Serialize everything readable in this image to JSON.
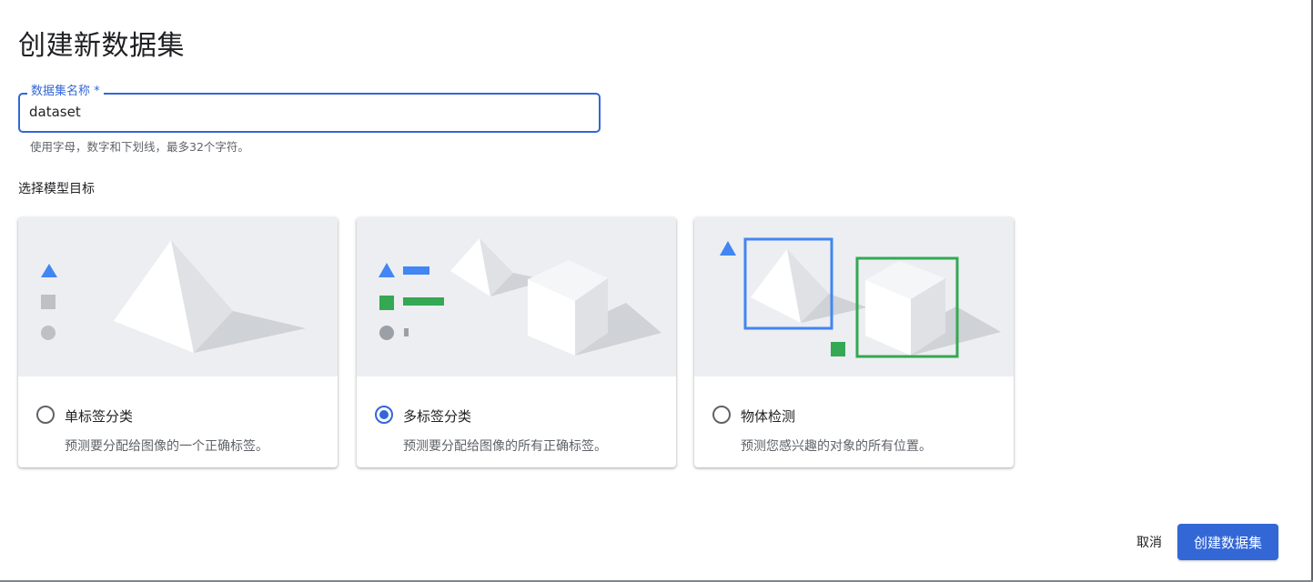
{
  "dialog": {
    "title": "创建新数据集"
  },
  "dataset_name": {
    "label": "数据集名称 *",
    "value": "dataset",
    "hint": "使用字母，数字和下划线，最多32个字符。"
  },
  "objective": {
    "section_label": "选择模型目标",
    "options": [
      {
        "title": "单标签分类",
        "description": "预测要分配给图像的一个正确标签。",
        "selected": false
      },
      {
        "title": "多标签分类",
        "description": "预测要分配给图像的所有正确标签。",
        "selected": true
      },
      {
        "title": "物体检测",
        "description": "预测您感兴趣的对象的所有位置。",
        "selected": false
      }
    ]
  },
  "actions": {
    "cancel_label": "取消",
    "create_label": "创建数据集"
  },
  "colors": {
    "accent": "#3367d6",
    "illustration_bg": "#eceef1",
    "blue_shape": "#4285f4",
    "green_shape": "#34a853",
    "gray_shape": "#bdc1c6"
  }
}
